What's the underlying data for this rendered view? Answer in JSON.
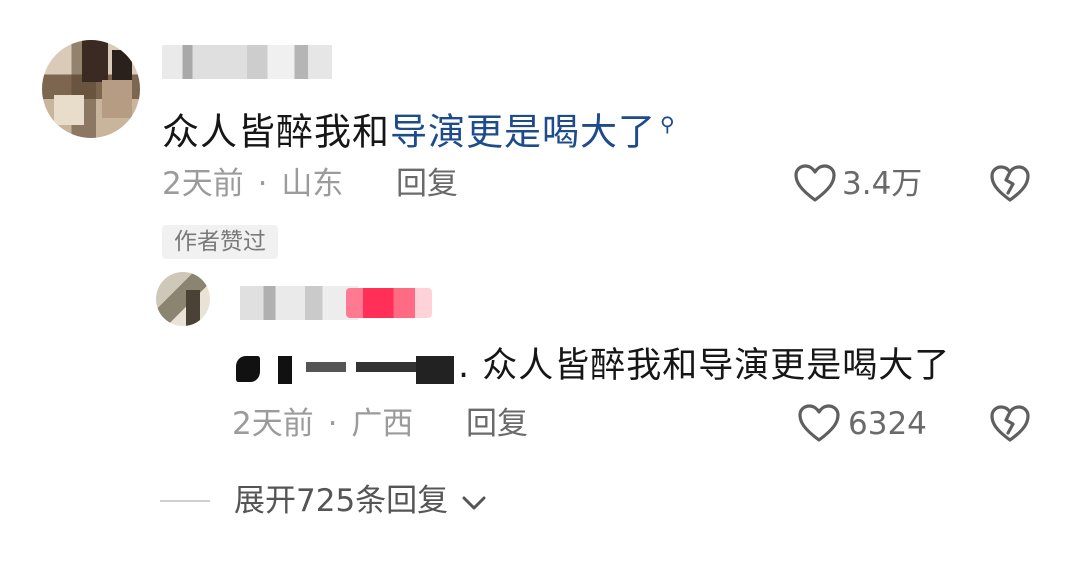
{
  "comment": {
    "text_plain": "众人皆醉我和",
    "text_link": "导演更是喝大了",
    "time": "2天前",
    "separator": "·",
    "location": "山东",
    "reply_label": "回复",
    "like_count": "3.4万",
    "author_liked_tag": "作者赞过"
  },
  "reply": {
    "mention_suffix": ".",
    "text": "众人皆醉我和导演更是喝大了",
    "time": "2天前",
    "separator": "·",
    "location": "广西",
    "reply_label": "回复",
    "like_count": "6324"
  },
  "expand_replies": {
    "label": "展开725条回复"
  },
  "icons": {
    "like": "heart-outline-icon",
    "dislike": "broken-heart-icon",
    "search": "search-icon",
    "expand": "chevron-down-icon"
  },
  "colors": {
    "link": "#1e4b8c",
    "meta": "#9b9b9b"
  }
}
